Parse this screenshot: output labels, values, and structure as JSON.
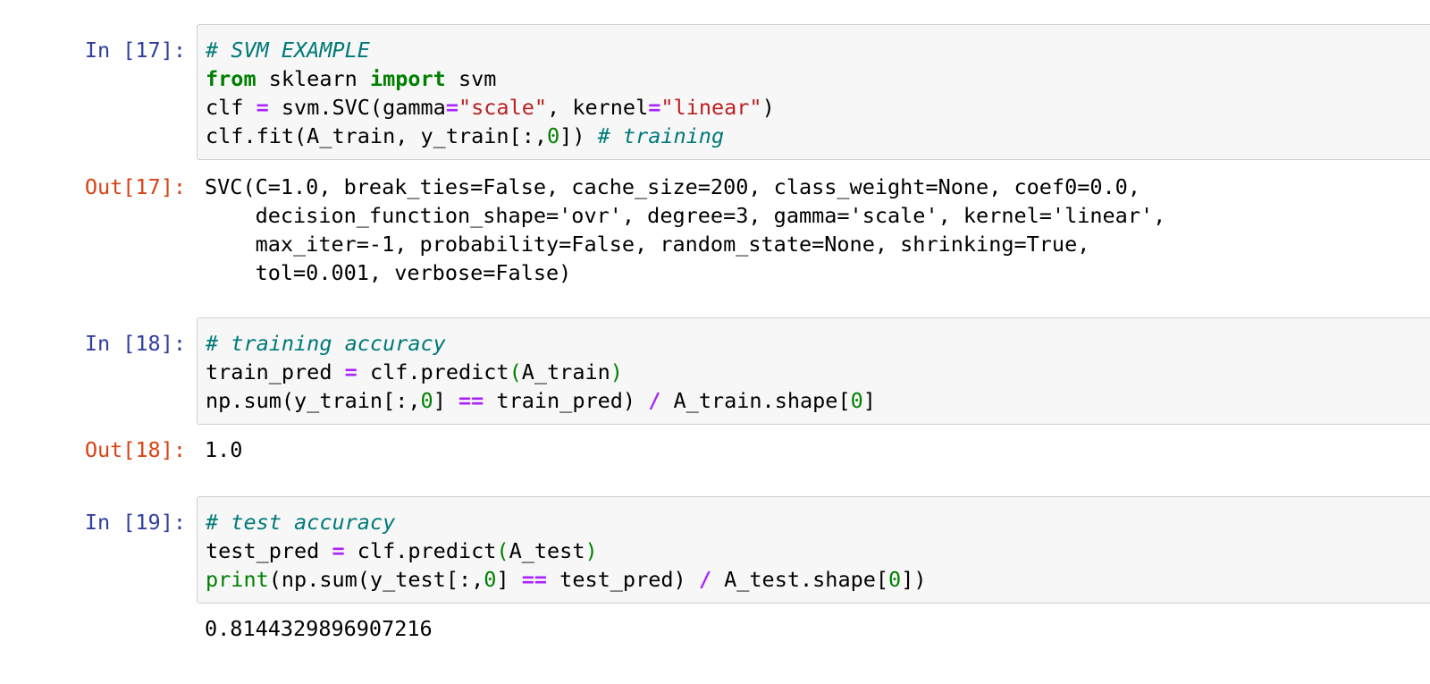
{
  "cells": [
    {
      "in_prompt": "In [17]:",
      "input_lines": [
        [
          {
            "t": "# SVM EXAMPLE",
            "c": "cm"
          }
        ],
        [
          {
            "t": "from",
            "c": "kw"
          },
          {
            "t": " sklearn ",
            "c": ""
          },
          {
            "t": "import",
            "c": "kw"
          },
          {
            "t": " svm",
            "c": ""
          }
        ],
        [
          {
            "t": "clf ",
            "c": ""
          },
          {
            "t": "=",
            "c": "op"
          },
          {
            "t": " svm.SVC(gamma",
            "c": ""
          },
          {
            "t": "=",
            "c": "op"
          },
          {
            "t": "\"scale\"",
            "c": "st"
          },
          {
            "t": ", kernel",
            "c": ""
          },
          {
            "t": "=",
            "c": "op"
          },
          {
            "t": "\"linear\"",
            "c": "st"
          },
          {
            "t": ")",
            "c": ""
          }
        ],
        [
          {
            "t": "clf.fit(A_train, y_train[:,",
            "c": ""
          },
          {
            "t": "0",
            "c": "nu"
          },
          {
            "t": "]) ",
            "c": ""
          },
          {
            "t": "# training",
            "c": "cm"
          }
        ]
      ],
      "out_prompt": "Out[17]:",
      "output_lines": [
        "SVC(C=1.0, break_ties=False, cache_size=200, class_weight=None, coef0=0.0,",
        "    decision_function_shape='ovr', degree=3, gamma='scale', kernel='linear',",
        "    max_iter=-1, probability=False, random_state=None, shrinking=True,",
        "    tol=0.001, verbose=False)"
      ]
    },
    {
      "in_prompt": "In [18]:",
      "input_lines": [
        [
          {
            "t": "# training accuracy",
            "c": "cm"
          }
        ],
        [
          {
            "t": "train_pred ",
            "c": ""
          },
          {
            "t": "=",
            "c": "op"
          },
          {
            "t": " clf.predict",
            "c": ""
          },
          {
            "t": "(",
            "c": "pu"
          },
          {
            "t": "A_train",
            "c": ""
          },
          {
            "t": ")",
            "c": "pu"
          }
        ],
        [
          {
            "t": "np.sum(y_train[:,",
            "c": ""
          },
          {
            "t": "0",
            "c": "nu"
          },
          {
            "t": "] ",
            "c": ""
          },
          {
            "t": "==",
            "c": "op"
          },
          {
            "t": " train_pred) ",
            "c": ""
          },
          {
            "t": "/",
            "c": "op"
          },
          {
            "t": " A_train.shape[",
            "c": ""
          },
          {
            "t": "0",
            "c": "nu"
          },
          {
            "t": "]",
            "c": ""
          }
        ]
      ],
      "out_prompt": "Out[18]:",
      "output_lines": [
        "1.0"
      ]
    },
    {
      "in_prompt": "In [19]:",
      "input_lines": [
        [
          {
            "t": "# test accuracy",
            "c": "cm"
          }
        ],
        [
          {
            "t": "test_pred ",
            "c": ""
          },
          {
            "t": "=",
            "c": "op"
          },
          {
            "t": " clf.predict",
            "c": ""
          },
          {
            "t": "(",
            "c": "pu"
          },
          {
            "t": "A_test",
            "c": ""
          },
          {
            "t": ")",
            "c": "pu"
          }
        ],
        [
          {
            "t": "print",
            "c": "nu"
          },
          {
            "t": "(np.sum(y_test[:,",
            "c": ""
          },
          {
            "t": "0",
            "c": "nu"
          },
          {
            "t": "] ",
            "c": ""
          },
          {
            "t": "==",
            "c": "op"
          },
          {
            "t": " test_pred) ",
            "c": ""
          },
          {
            "t": "/",
            "c": "op"
          },
          {
            "t": " A_test.shape[",
            "c": ""
          },
          {
            "t": "0",
            "c": "nu"
          },
          {
            "t": "])",
            "c": ""
          }
        ]
      ],
      "out_prompt": "",
      "output_lines": [
        "0.8144329896907216"
      ]
    }
  ]
}
